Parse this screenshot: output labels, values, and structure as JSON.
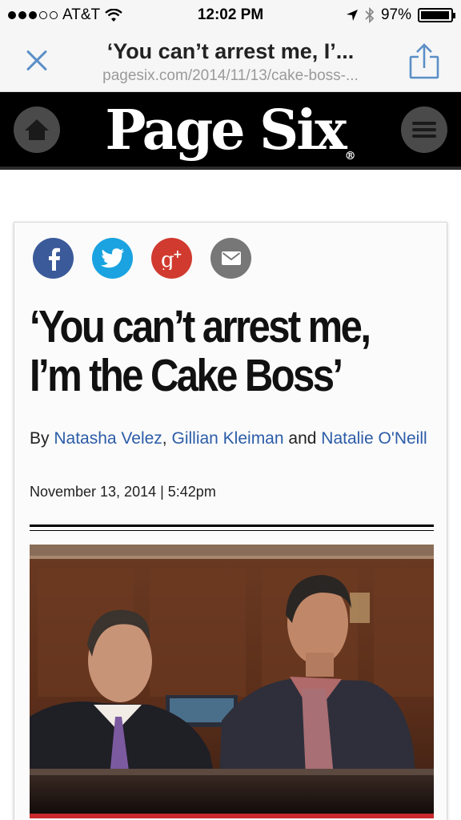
{
  "status_bar": {
    "carrier": "AT&T",
    "time": "12:02 PM",
    "battery": "97%",
    "battery_level": 0.97
  },
  "browser": {
    "title": "‘You can’t arrest me, I’...",
    "url": "pagesix.com/2014/11/13/cake-boss-..."
  },
  "site": {
    "logo": "Page Six",
    "registered": "®"
  },
  "article": {
    "share_icons": [
      "facebook-icon",
      "twitter-icon",
      "google-plus-icon",
      "email-icon"
    ],
    "headline_line1": "‘You can’t arrest me,",
    "headline_line2": "I’m the Cake Boss’",
    "by": "By",
    "author1": "Natasha Velez",
    "sep": ",",
    "author2": "Gillian Kleiman",
    "and": "and",
    "author3": "Natalie O'Neill",
    "date": "November 13, 2014 | 5:42pm"
  },
  "colors": {
    "link": "#2c5ca8",
    "facebook": "#3b5a9a",
    "twitter": "#1aa3e0",
    "google_plus": "#d13a2f",
    "email": "#777777",
    "accent_red": "#c8282e"
  }
}
